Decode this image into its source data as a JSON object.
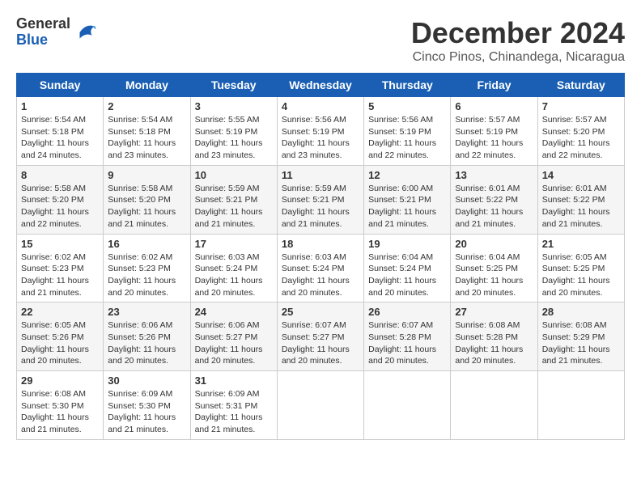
{
  "logo": {
    "general": "General",
    "blue": "Blue"
  },
  "title": "December 2024",
  "subtitle": "Cinco Pinos, Chinandega, Nicaragua",
  "headers": [
    "Sunday",
    "Monday",
    "Tuesday",
    "Wednesday",
    "Thursday",
    "Friday",
    "Saturday"
  ],
  "weeks": [
    [
      {
        "day": "1",
        "sunrise": "5:54 AM",
        "sunset": "5:18 PM",
        "daylight": "11 hours and 24 minutes."
      },
      {
        "day": "2",
        "sunrise": "5:54 AM",
        "sunset": "5:18 PM",
        "daylight": "11 hours and 23 minutes."
      },
      {
        "day": "3",
        "sunrise": "5:55 AM",
        "sunset": "5:19 PM",
        "daylight": "11 hours and 23 minutes."
      },
      {
        "day": "4",
        "sunrise": "5:56 AM",
        "sunset": "5:19 PM",
        "daylight": "11 hours and 23 minutes."
      },
      {
        "day": "5",
        "sunrise": "5:56 AM",
        "sunset": "5:19 PM",
        "daylight": "11 hours and 22 minutes."
      },
      {
        "day": "6",
        "sunrise": "5:57 AM",
        "sunset": "5:19 PM",
        "daylight": "11 hours and 22 minutes."
      },
      {
        "day": "7",
        "sunrise": "5:57 AM",
        "sunset": "5:20 PM",
        "daylight": "11 hours and 22 minutes."
      }
    ],
    [
      {
        "day": "8",
        "sunrise": "5:58 AM",
        "sunset": "5:20 PM",
        "daylight": "11 hours and 22 minutes."
      },
      {
        "day": "9",
        "sunrise": "5:58 AM",
        "sunset": "5:20 PM",
        "daylight": "11 hours and 21 minutes."
      },
      {
        "day": "10",
        "sunrise": "5:59 AM",
        "sunset": "5:21 PM",
        "daylight": "11 hours and 21 minutes."
      },
      {
        "day": "11",
        "sunrise": "5:59 AM",
        "sunset": "5:21 PM",
        "daylight": "11 hours and 21 minutes."
      },
      {
        "day": "12",
        "sunrise": "6:00 AM",
        "sunset": "5:21 PM",
        "daylight": "11 hours and 21 minutes."
      },
      {
        "day": "13",
        "sunrise": "6:01 AM",
        "sunset": "5:22 PM",
        "daylight": "11 hours and 21 minutes."
      },
      {
        "day": "14",
        "sunrise": "6:01 AM",
        "sunset": "5:22 PM",
        "daylight": "11 hours and 21 minutes."
      }
    ],
    [
      {
        "day": "15",
        "sunrise": "6:02 AM",
        "sunset": "5:23 PM",
        "daylight": "11 hours and 21 minutes."
      },
      {
        "day": "16",
        "sunrise": "6:02 AM",
        "sunset": "5:23 PM",
        "daylight": "11 hours and 20 minutes."
      },
      {
        "day": "17",
        "sunrise": "6:03 AM",
        "sunset": "5:24 PM",
        "daylight": "11 hours and 20 minutes."
      },
      {
        "day": "18",
        "sunrise": "6:03 AM",
        "sunset": "5:24 PM",
        "daylight": "11 hours and 20 minutes."
      },
      {
        "day": "19",
        "sunrise": "6:04 AM",
        "sunset": "5:24 PM",
        "daylight": "11 hours and 20 minutes."
      },
      {
        "day": "20",
        "sunrise": "6:04 AM",
        "sunset": "5:25 PM",
        "daylight": "11 hours and 20 minutes."
      },
      {
        "day": "21",
        "sunrise": "6:05 AM",
        "sunset": "5:25 PM",
        "daylight": "11 hours and 20 minutes."
      }
    ],
    [
      {
        "day": "22",
        "sunrise": "6:05 AM",
        "sunset": "5:26 PM",
        "daylight": "11 hours and 20 minutes."
      },
      {
        "day": "23",
        "sunrise": "6:06 AM",
        "sunset": "5:26 PM",
        "daylight": "11 hours and 20 minutes."
      },
      {
        "day": "24",
        "sunrise": "6:06 AM",
        "sunset": "5:27 PM",
        "daylight": "11 hours and 20 minutes."
      },
      {
        "day": "25",
        "sunrise": "6:07 AM",
        "sunset": "5:27 PM",
        "daylight": "11 hours and 20 minutes."
      },
      {
        "day": "26",
        "sunrise": "6:07 AM",
        "sunset": "5:28 PM",
        "daylight": "11 hours and 20 minutes."
      },
      {
        "day": "27",
        "sunrise": "6:08 AM",
        "sunset": "5:28 PM",
        "daylight": "11 hours and 20 minutes."
      },
      {
        "day": "28",
        "sunrise": "6:08 AM",
        "sunset": "5:29 PM",
        "daylight": "11 hours and 21 minutes."
      }
    ],
    [
      {
        "day": "29",
        "sunrise": "6:08 AM",
        "sunset": "5:30 PM",
        "daylight": "11 hours and 21 minutes."
      },
      {
        "day": "30",
        "sunrise": "6:09 AM",
        "sunset": "5:30 PM",
        "daylight": "11 hours and 21 minutes."
      },
      {
        "day": "31",
        "sunrise": "6:09 AM",
        "sunset": "5:31 PM",
        "daylight": "11 hours and 21 minutes."
      },
      null,
      null,
      null,
      null
    ]
  ]
}
